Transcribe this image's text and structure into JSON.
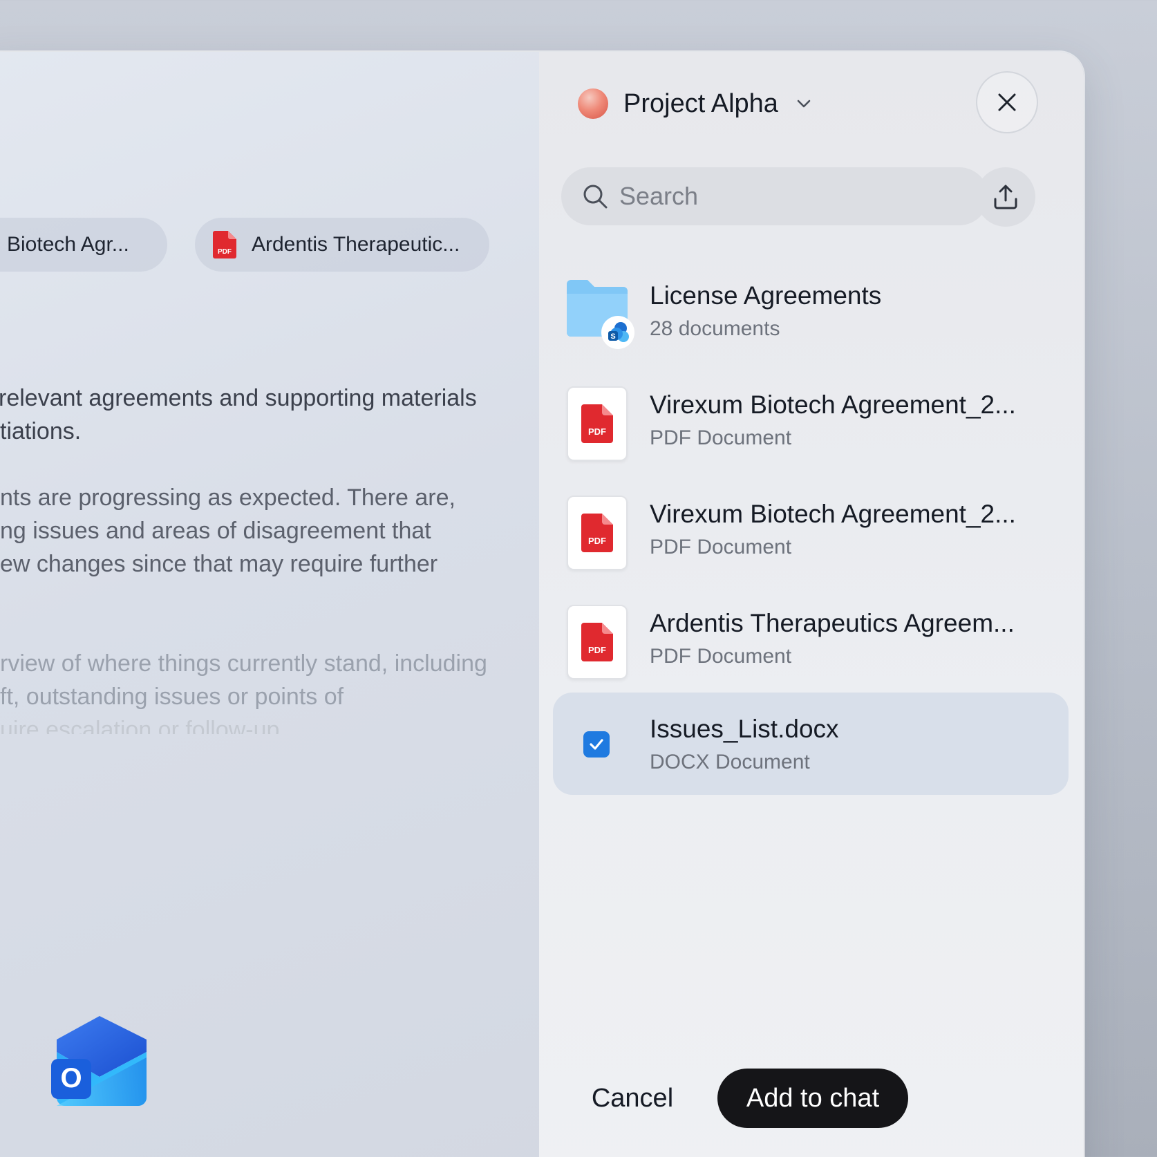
{
  "chips": [
    {
      "label": "um Biotech Agr...",
      "icon": "pdf-icon"
    },
    {
      "label": "Ardentis Therapeutic...",
      "icon": "pdf-icon"
    }
  ],
  "chat": {
    "p1": [
      "relevant agreements and supporting materials",
      "tiations."
    ],
    "p2": [
      "nts are progressing as expected. There are,",
      "ng issues and areas of disagreement that",
      "ew changes since that may require further"
    ],
    "p3": [
      "rview of where things currently stand, including",
      "ft, outstanding issues or points of",
      "uire escalation or follow-up."
    ]
  },
  "panel": {
    "project_title": "Project Alpha",
    "search_placeholder": "Search",
    "items": [
      {
        "title": "License Agreements",
        "subtitle": "28 documents",
        "type": "folder",
        "icon": "sharepoint-folder-icon"
      },
      {
        "title": "Virexum Biotech Agreement_2...",
        "subtitle": "PDF Document",
        "type": "pdf",
        "icon": "pdf-icon"
      },
      {
        "title": "Virexum Biotech Agreement_2...",
        "subtitle": "PDF Document",
        "type": "pdf",
        "icon": "pdf-icon"
      },
      {
        "title": "Ardentis Therapeutics Agreem...",
        "subtitle": "PDF Document",
        "type": "pdf",
        "icon": "pdf-icon"
      },
      {
        "title": "Issues_List.docx",
        "subtitle": "DOCX Document",
        "type": "docx",
        "selected": true,
        "icon": "checkbox-checked-icon"
      }
    ],
    "cancel_label": "Cancel",
    "add_label": "Add to chat"
  },
  "colors": {
    "accent": "#1f7ae0",
    "pdf_red": "#e0292f",
    "primary_button": "#151518",
    "selected_row": "#d8dfea"
  }
}
